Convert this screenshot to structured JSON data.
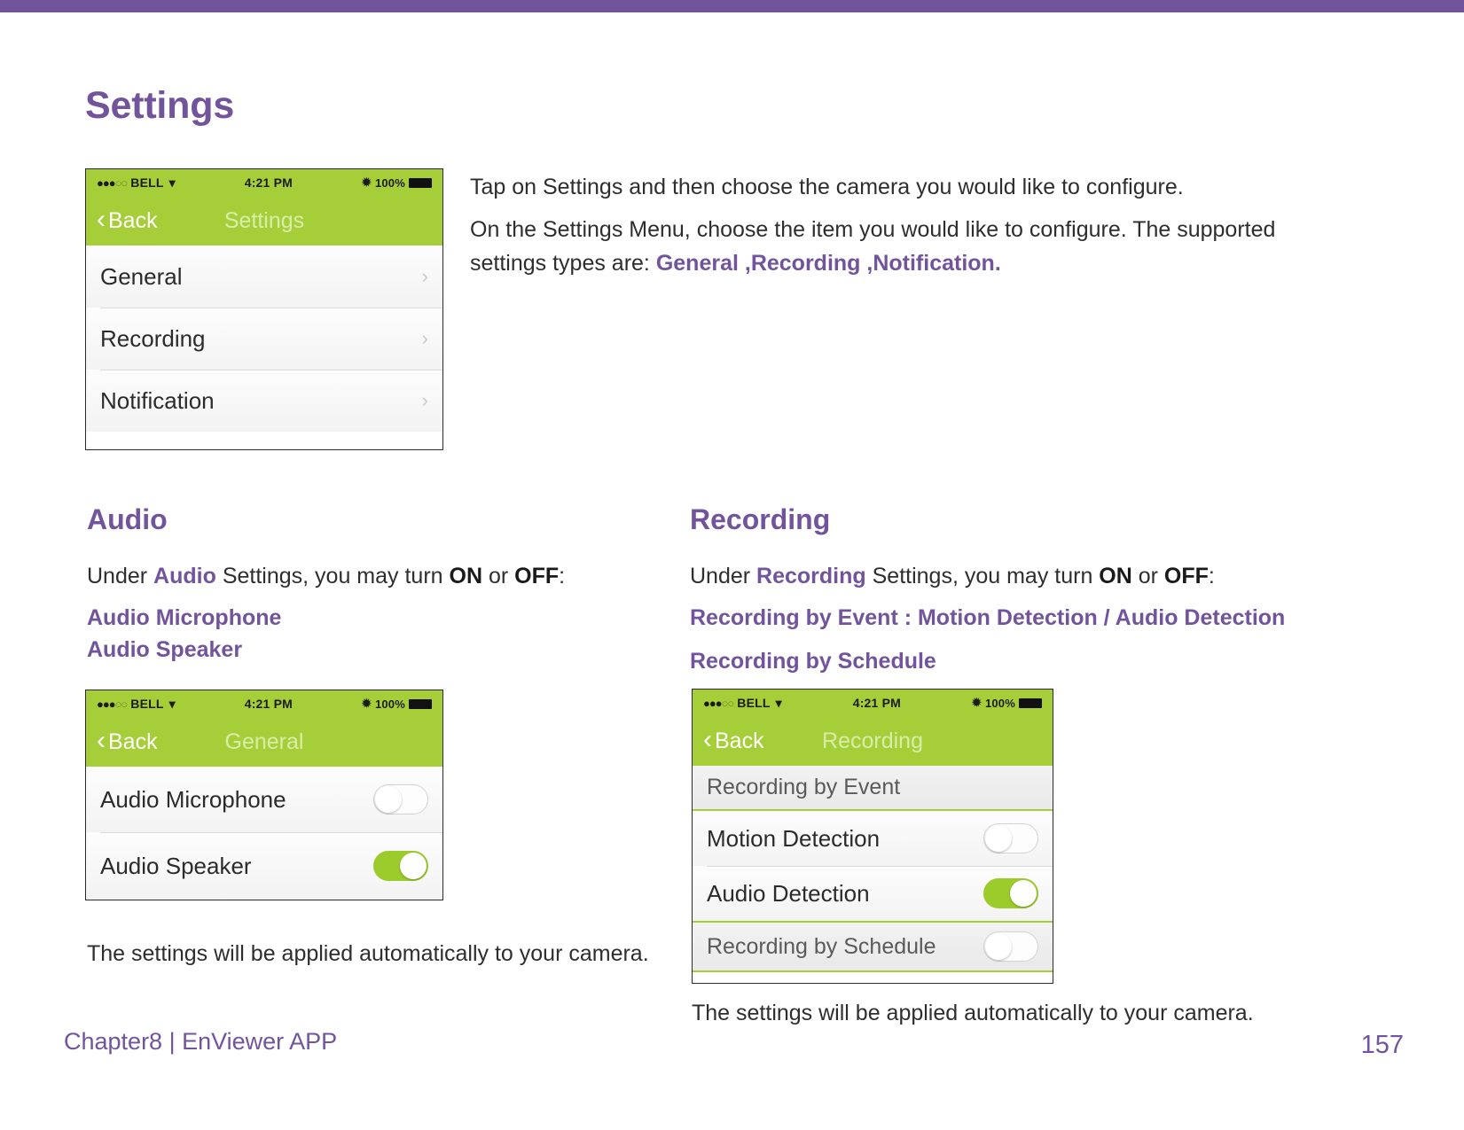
{
  "document": {
    "title": "Settings",
    "accent_color": "#72549c",
    "green_color": "#a6ce39"
  },
  "intro": {
    "line1": "Tap on Settings and then choose the camera you would like to configure.",
    "line2_part1": "On the Settings Menu, choose the item you would like to configure. The supported settings types are: ",
    "line2_accent": "General ,Recording ,Notification."
  },
  "sections": {
    "audio": {
      "heading": "Audio",
      "under_prefix": "Under ",
      "under_accent": "Audio",
      "under_middle": " Settings, you may turn ",
      "under_on": "ON",
      "under_or": " or ",
      "under_off": "OFF",
      "under_suffix": ":",
      "items": [
        "Audio Microphone",
        "Audio Speaker"
      ],
      "note": "The settings will be applied automatically to your camera."
    },
    "recording": {
      "heading": "Recording",
      "under_prefix": "Under ",
      "under_accent": "Recording",
      "under_middle": " Settings, you may turn ",
      "under_on": "ON",
      "under_or": " or ",
      "under_off": "OFF",
      "under_suffix": ":",
      "item1": "Recording by Event : Motion Detection / Audio Detection",
      "item2": "Recording by Schedule",
      "note": "The settings will be applied automatically to your camera."
    }
  },
  "phone_settings": {
    "statusbar": {
      "dots_filled": "●●●",
      "dots_hollow": "○○",
      "carrier": "BELL",
      "wifi_icon": "wifi-icon",
      "time": "4:21 PM",
      "bluetooth_icon": "bluetooth-icon",
      "battery_percent": "100%",
      "battery_icon": "battery-icon"
    },
    "navbar": {
      "back_label": "Back",
      "back_icon": "chevron-left-icon",
      "title": "Settings"
    },
    "rows": [
      {
        "label": "General",
        "chevron": "›"
      },
      {
        "label": "Recording",
        "chevron": "›"
      },
      {
        "label": "Notification",
        "chevron": "›"
      }
    ]
  },
  "phone_general": {
    "statusbar": {
      "dots_filled": "●●●",
      "dots_hollow": "○○",
      "carrier": "BELL",
      "time": "4:21 PM",
      "battery_percent": "100%"
    },
    "navbar": {
      "back_label": "Back",
      "title": "General"
    },
    "rows": [
      {
        "label": "Audio Microphone",
        "state": "off"
      },
      {
        "label": "Audio Speaker",
        "state": "on"
      }
    ]
  },
  "phone_recording": {
    "statusbar": {
      "dots_filled": "●●●",
      "dots_hollow": "○○",
      "carrier": "BELL",
      "time": "4:21 PM",
      "battery_percent": "100%"
    },
    "navbar": {
      "back_label": "Back",
      "title": "Recording"
    },
    "section_event": "Recording by Event",
    "rows": [
      {
        "label": "Motion Detection",
        "state": "off"
      },
      {
        "label": "Audio Detection",
        "state": "on"
      }
    ],
    "section_schedule": "Recording by Schedule",
    "schedule_state": "off"
  },
  "footer": {
    "chapter": "Chapter8  |  EnViewer APP",
    "page_number": "157"
  }
}
